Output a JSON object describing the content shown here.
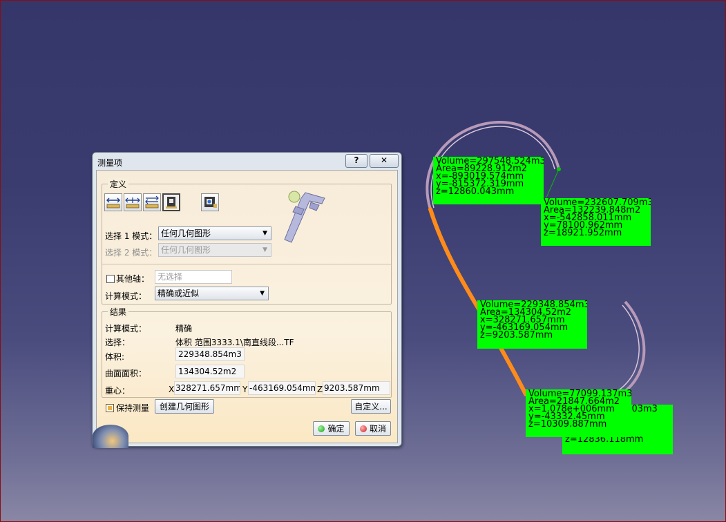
{
  "dialog": {
    "title": "测量项",
    "help_label": "?",
    "close_label": "✕",
    "definition": {
      "group_title": "定义",
      "tools": [
        {
          "icon": "measure-between-icon",
          "selected": false
        },
        {
          "icon": "measure-in-chain-icon",
          "selected": false
        },
        {
          "icon": "measure-fan-icon",
          "selected": false
        },
        {
          "icon": "measure-item-icon",
          "selected": true
        },
        {
          "icon": "measure-thickness-icon",
          "selected": false
        }
      ],
      "select1_label": "选择 1 模式：",
      "select1_value": "任何几何图形",
      "select2_label": "选择 2 模式：",
      "select2_value": "任何几何图形",
      "other_axis_label": "其他轴：",
      "other_axis_placeholder": "无选择",
      "calc_mode_label": "计算模式：",
      "calc_mode_value": "精确或近似"
    },
    "results": {
      "group_title": "结果",
      "calc_mode_label": "计算模式：",
      "calc_mode_value": "精确",
      "selection_label": "选择：",
      "selection_value": "体积 范围3333.1\\南直线段...TF",
      "volume_label": "体积:",
      "volume_value": "229348.854m3",
      "area_label": "曲面面积：",
      "area_value": "134304.52m2",
      "cog_label": "重心：",
      "x_label": "X",
      "x_value": "328271.657mm",
      "y_label": "Y",
      "y_value": "-463169.054mm",
      "z_label": "Z",
      "z_value": "9203.587mm"
    },
    "keep_measure_label": "保持测量",
    "keep_measure_checked": true,
    "create_geometry_label": "创建几何图形",
    "customize_label": "自定义...",
    "ok_label": "确定",
    "cancel_label": "取消"
  },
  "viewport": {
    "labels": [
      {
        "text": "Volume=297548.524m3\nArea=89228.912m2\nx=-893019.574mm\ny=-815372.319mm\nz=12860.043mm"
      },
      {
        "text": "Volume=232607.709m3\nArea=132239.848m2\nx=-542858.011mm\ny=78100.962mm\nz=18921.952mm"
      },
      {
        "text": "Volume=229348.854m3\nArea=134304.52m2\nx=328271.657mm\ny=-463169.054mm\nz=9203.587mm"
      },
      {
        "text": "Volume=77099.137m3\nArea=21847.664m2\nx=1.078e+006mm\ny=-43332.45mm\nz=10309.887mm"
      },
      {
        "text": "Volume=179.403m3\nArea=175m2\nx=mm\ny=mm\nz=12836.118mm"
      }
    ],
    "colors": {
      "label_bg": "#00ff00",
      "highlight": "#ff8c1a",
      "curve": "#b89ab8"
    }
  }
}
